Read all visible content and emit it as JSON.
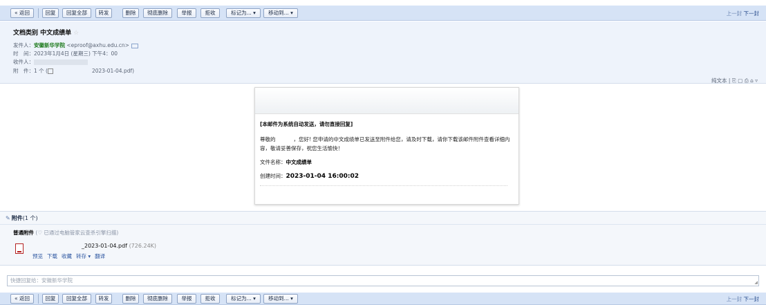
{
  "toolbar": {
    "back": "« 返回",
    "reply": "回复",
    "reply_all": "回复全部",
    "forward": "转发",
    "delete": "删除",
    "delete_permanently": "彻底删除",
    "report": "举报",
    "reject": "拒收",
    "mark_as": "标记为... ▾",
    "move_to": "移动到... ▾",
    "prev": "上一封",
    "next": "下一封"
  },
  "header": {
    "subject": "文档类别 中文成绩单",
    "star": "☆",
    "from_label": "发件人：",
    "from_name": "安徽新华学院",
    "from_email": "<eproof@axhu.edu.cn>",
    "time_label": "时　间：",
    "time_value": "2023年1月4日 (星期三) 下午4：00",
    "to_label": "收件人：",
    "attach_label": "附　件：",
    "attach_count": "1 个 (",
    "attach_file_tail": "2023-01-04.pdf)",
    "right_tools": "纯文本 | ⎘ ▢ ⎙ ⌂ ▿"
  },
  "content": {
    "notice": "[本邮件为系统自动发送，请勿直接回复]",
    "greet_prefix": "尊敬的",
    "greet_body": "，您好! 您申请的中文成绩单已发送至附件给您，请及时下载，请你下载该邮件附件查看详细内容，敬请妥善保存，祝您生活愉快！",
    "file_label": "文件名称：",
    "file_name": "中文成绩单",
    "created_label": "创建时间：",
    "created_value": "2023-01-04 16:00:02"
  },
  "attachments": {
    "title": "附件",
    "count": "(1 个)",
    "kind": "普通附件",
    "scan_note": "(♡ 已通过电脑管家云查杀引擎扫描)",
    "file_name": "_2023-01-04.pdf",
    "file_size": "(726.24K)",
    "links": [
      "预览",
      "下载",
      "收藏",
      "转存 ▾",
      "翻译"
    ]
  },
  "reply": {
    "placeholder": "快捷回复给：安徽新华学院"
  },
  "colors": {
    "toolbar_bg": "#d6e3f6",
    "header_bg": "#eef3fb",
    "sender_green": "#1d7a1d",
    "link_blue": "#2c56a0"
  }
}
